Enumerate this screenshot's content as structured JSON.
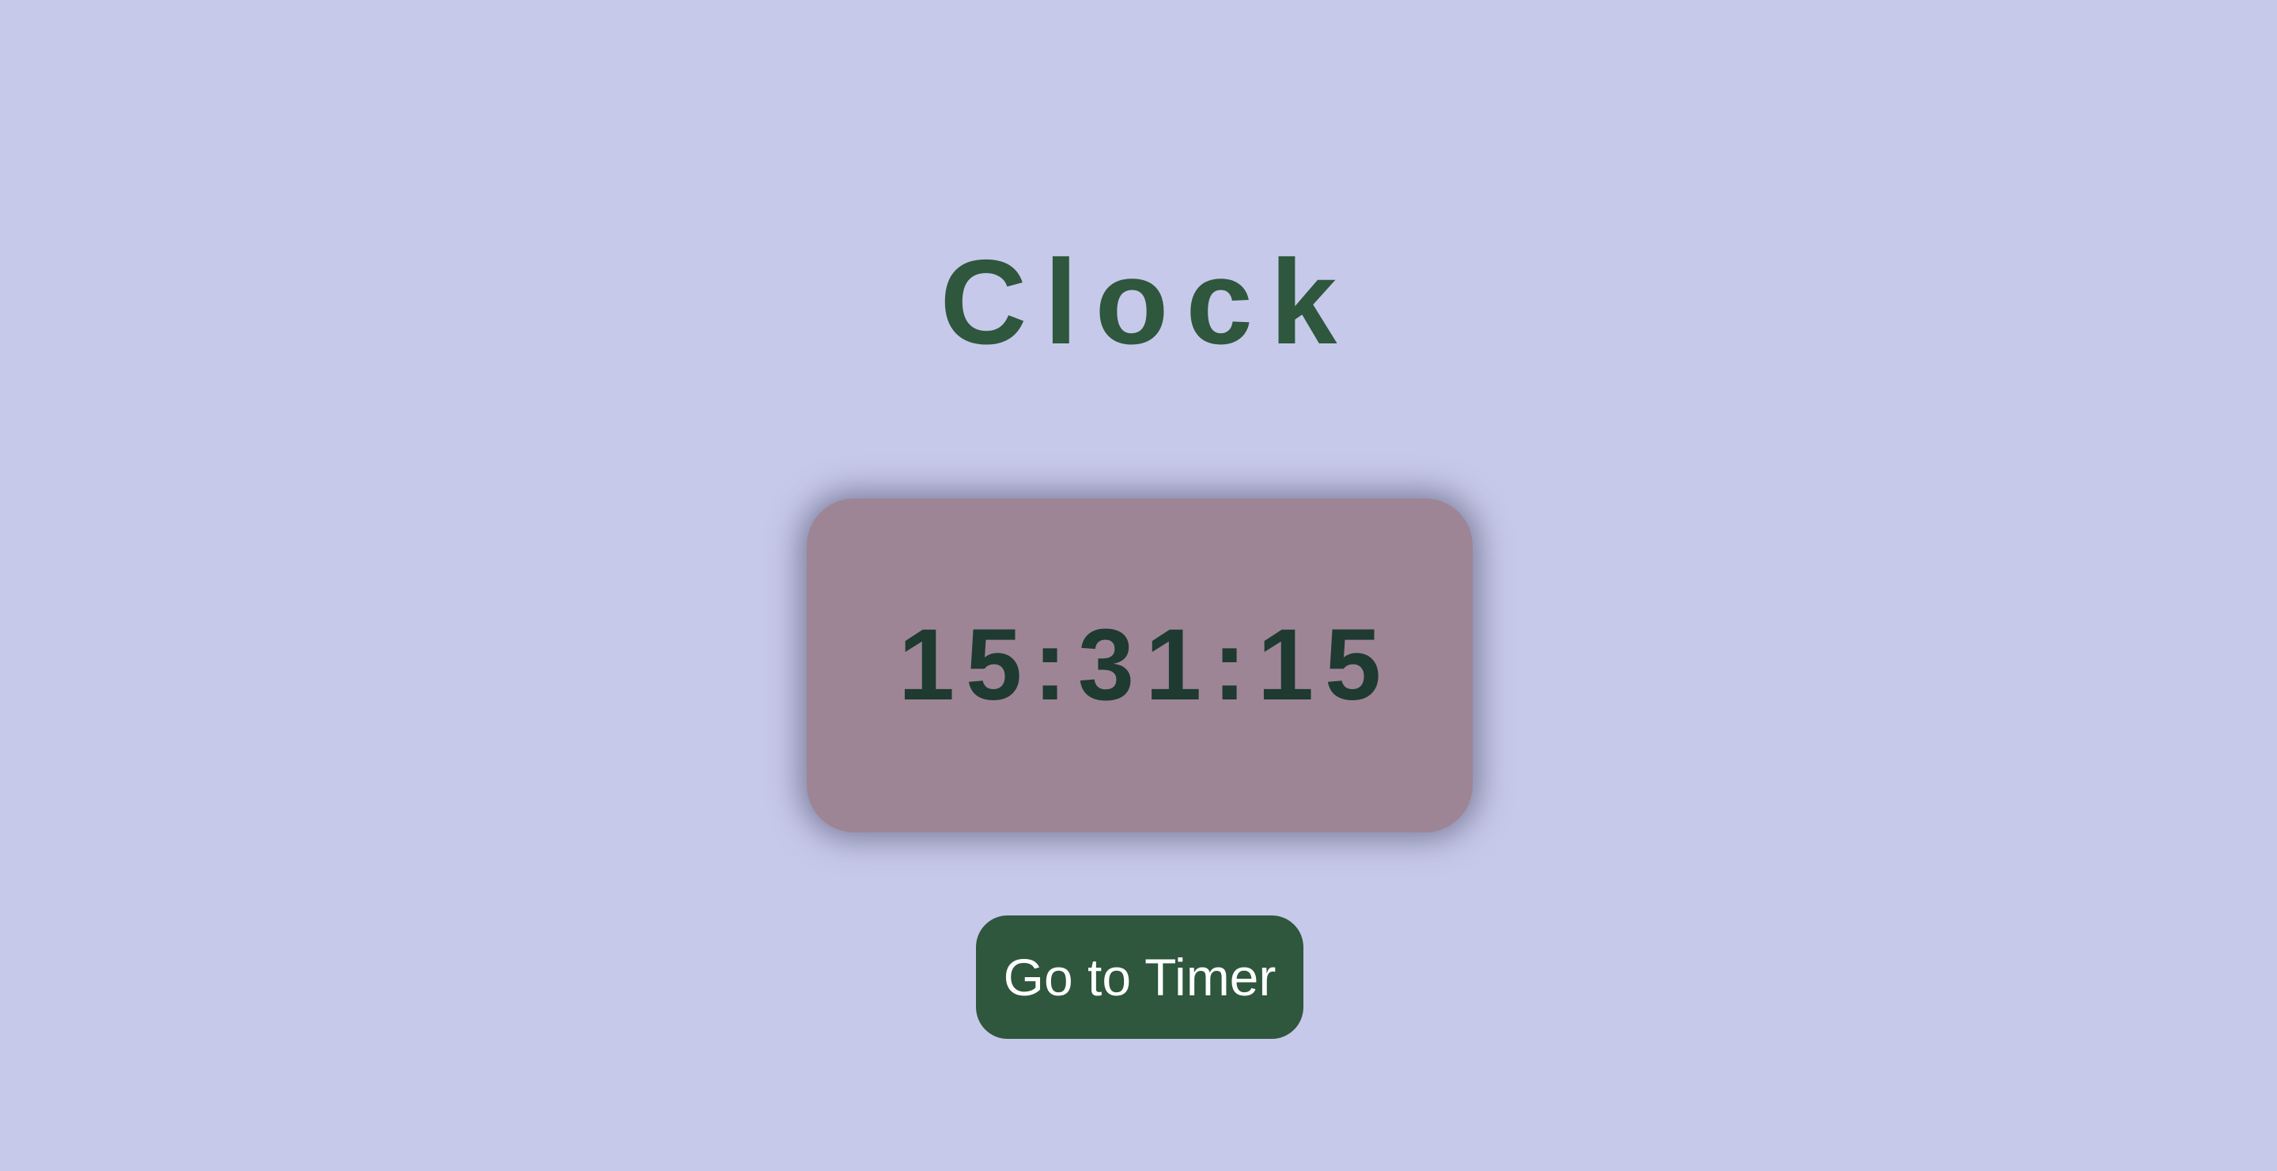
{
  "page": {
    "title": "Clock",
    "background_color": "#c7c9ea"
  },
  "clock": {
    "time": "15:31:15",
    "card_color": "#9e8595",
    "text_color": "#1e3a31"
  },
  "actions": {
    "timer_button_label": "Go to Timer",
    "button_color": "#2e573d"
  }
}
